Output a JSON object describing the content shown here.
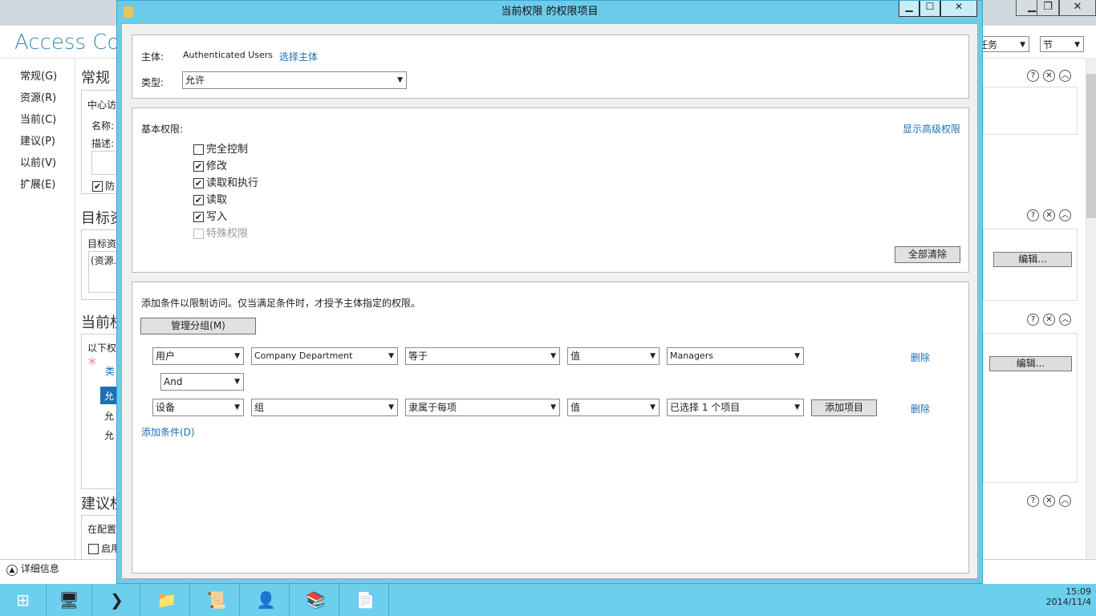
{
  "background": {
    "app_title": "Access Cont",
    "nav": [
      "常规(G)",
      "资源(R)",
      "当前(C)",
      "建议(P)",
      "以前(V)",
      "扩展(E)"
    ],
    "sections": [
      "常规",
      "目标资",
      "当前权",
      "建议权"
    ],
    "general": {
      "group": "中心访",
      "name_label": "名称:",
      "desc_label": "描述:",
      "protect": "防"
    },
    "target": {
      "label": "目标资",
      "value": "(资源."
    },
    "current": {
      "label": "以下权",
      "type_col": "类",
      "rows": [
        "允",
        "允",
        "允"
      ]
    },
    "proposed": {
      "label": "在配置",
      "enable": "启用"
    },
    "tasks": "任务",
    "section_dd": "节",
    "edit": "编辑...",
    "details": "详细信息"
  },
  "dialog": {
    "title": "当前权限 的权限项目",
    "principal_label": "主体:",
    "principal_value": "Authenticated Users",
    "select_principal": "选择主体",
    "type_label": "类型:",
    "type_value": "允许",
    "basic_label": "基本权限:",
    "show_advanced": "显示高级权限",
    "permissions": [
      {
        "label": "完全控制",
        "checked": false
      },
      {
        "label": "修改",
        "checked": true
      },
      {
        "label": "读取和执行",
        "checked": true
      },
      {
        "label": "读取",
        "checked": true
      },
      {
        "label": "写入",
        "checked": true
      },
      {
        "label": "特殊权限",
        "checked": false,
        "disabled": true
      }
    ],
    "clear_all": "全部清除",
    "cond_desc": "添加条件以限制访问。仅当满足条件时，才授予主体指定的权限。",
    "manage_groups": "管理分组(M)",
    "cond1": [
      "用户",
      "Company Department",
      "等于",
      "值",
      "Managers"
    ],
    "operator": "And",
    "cond2": [
      "设备",
      "组",
      "隶属于每项",
      "值",
      "已选择 1 个项目"
    ],
    "add_items": "添加项目",
    "delete": "删除",
    "add_condition": "添加条件(D)"
  },
  "clock": {
    "time": "15:09",
    "date": "2014/11/4"
  }
}
